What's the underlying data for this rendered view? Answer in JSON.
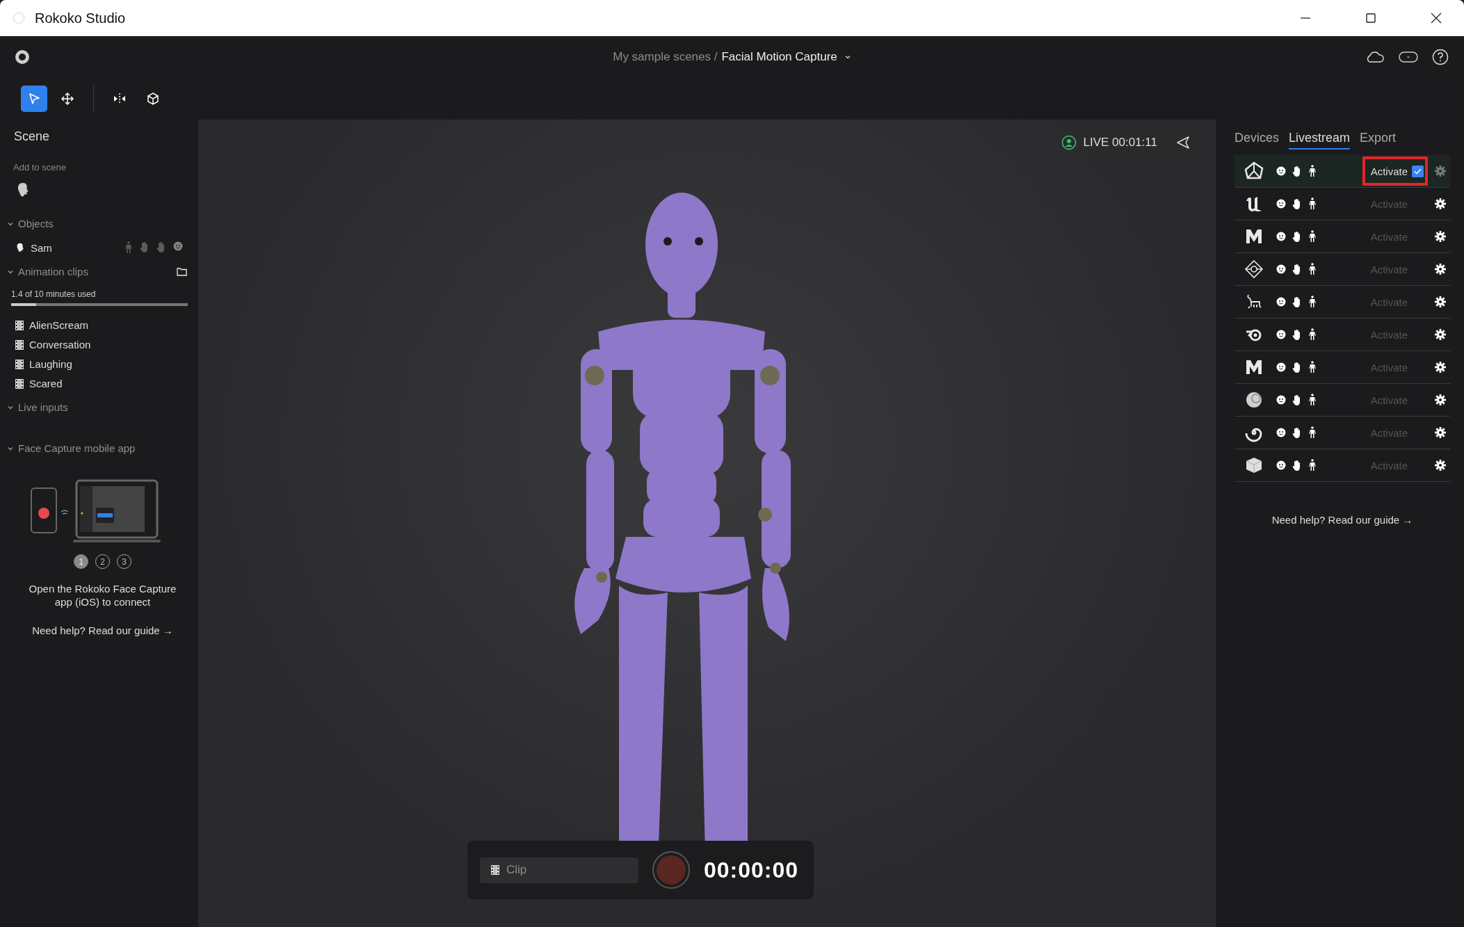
{
  "window": {
    "title": "Rokoko Studio"
  },
  "breadcrumb": {
    "parent": "My sample scenes /",
    "current": "Facial Motion Capture"
  },
  "tools": [
    {
      "kind": "select",
      "selected": true
    },
    {
      "kind": "move",
      "selected": false
    },
    {
      "kind": "mirror",
      "selected": false
    },
    {
      "kind": "cube",
      "selected": false
    }
  ],
  "scene": {
    "title": "Scene",
    "add_label": "Add to scene",
    "objects": {
      "title": "Objects",
      "expanded": true,
      "items": [
        {
          "name": "Sam"
        }
      ]
    },
    "clips": {
      "title": "Animation clips",
      "expanded": true,
      "usage": "1.4 of 10 minutes used",
      "level": 0.14,
      "items": [
        {
          "name": "AlienScream"
        },
        {
          "name": "Conversation"
        },
        {
          "name": "Laughing"
        },
        {
          "name": "Scared"
        }
      ]
    },
    "live_inputs": {
      "title": "Live inputs",
      "expanded": true
    },
    "face_capture": {
      "title": "Face Capture mobile app",
      "expanded": true,
      "steps": [
        {
          "label": "1",
          "selected": true
        },
        {
          "label": "2",
          "selected": false
        },
        {
          "label": "3",
          "selected": false
        }
      ],
      "description": "Open the Rokoko Face Capture app (iOS) to connect",
      "help": "Need help? Read our guide →"
    }
  },
  "viewport": {
    "live": "LIVE 00:01:11",
    "clip_field": {
      "placeholder": "Clip"
    },
    "timer": "00:00:00"
  },
  "right_panel": {
    "tabs": [
      {
        "label": "Devices",
        "selected": false
      },
      {
        "label": "Livestream",
        "selected": true
      },
      {
        "label": "Export",
        "selected": false
      }
    ],
    "integrations": [
      {
        "kind": "triangle",
        "activate": "Activate",
        "active": true,
        "highlighted": true
      },
      {
        "kind": "wave",
        "activate": "Activate",
        "active": false,
        "highlighted": false
      },
      {
        "kind": "block",
        "activate": "Activate",
        "active": false,
        "highlighted": false
      },
      {
        "kind": "diamond",
        "activate": "Activate",
        "active": false,
        "highlighted": false
      },
      {
        "kind": "creature",
        "activate": "Activate",
        "active": false,
        "highlighted": false
      },
      {
        "kind": "orbit",
        "activate": "Activate",
        "active": false,
        "highlighted": false
      },
      {
        "kind": "block",
        "activate": "Activate",
        "active": false,
        "highlighted": false
      },
      {
        "kind": "sphere",
        "activate": "Activate",
        "active": false,
        "highlighted": false
      },
      {
        "kind": "spiral",
        "activate": "Activate",
        "active": false,
        "highlighted": false
      },
      {
        "kind": "cube",
        "activate": "Activate",
        "active": false,
        "highlighted": false
      }
    ],
    "help": "Need help? Read our guide →"
  }
}
